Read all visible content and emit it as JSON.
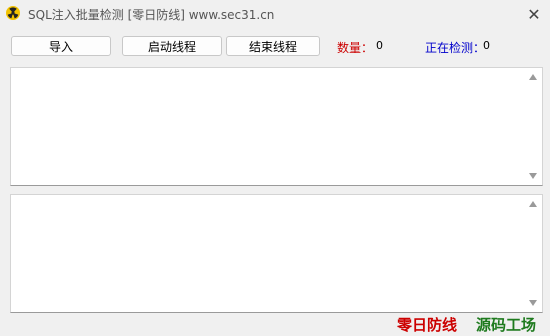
{
  "window": {
    "title": "SQL注入批量检测   [零日防线]    www.sec31.cn",
    "close_glyph": "✕"
  },
  "toolbar": {
    "import_label": "导入",
    "start_label": "启动线程",
    "stop_label": "结束线程"
  },
  "stats": {
    "count_label": "数量：",
    "count_value": "0",
    "count_color": "#cc0000",
    "checking_label": "正在检测：",
    "checking_value": "0",
    "checking_color": "#0000cc"
  },
  "footer": {
    "brand_1": "零日防线",
    "brand_2": "源码工场"
  },
  "icons": {
    "app": "radiation-icon",
    "close": "close-icon"
  }
}
